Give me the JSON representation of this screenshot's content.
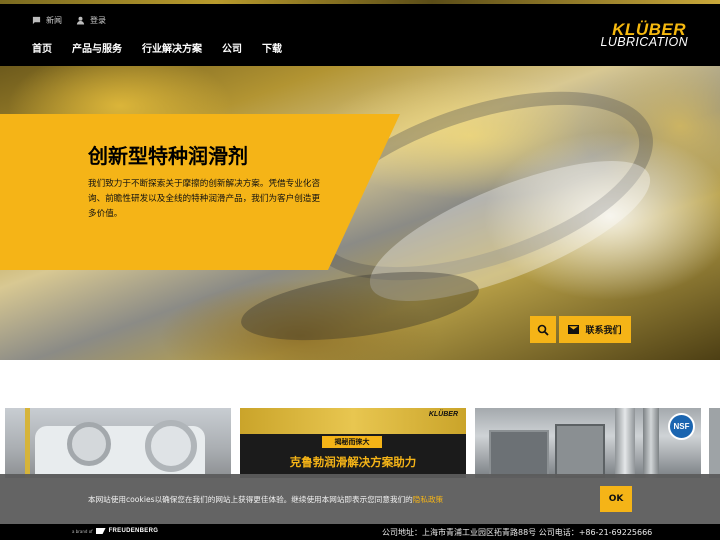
{
  "header": {
    "utility": [
      {
        "label": "新闻",
        "icon": "chat-icon"
      },
      {
        "label": "登录",
        "icon": "user-icon"
      }
    ],
    "nav": [
      "首页",
      "产品与服务",
      "行业解决方案",
      "公司",
      "下载"
    ],
    "logo": {
      "line1": "KLÜBER",
      "line2": "LUBRICATION"
    }
  },
  "hero": {
    "title": "创新型特种润滑剂",
    "text": "我们致力于不断探索关于摩擦的创新解决方案。凭借专业化咨询、前瞻性研发以及全线的特种润滑产品，我们为客户创造更多价值。",
    "contact_label": "联系我们"
  },
  "cards": [
    {
      "name": "card-industrial-machinery"
    },
    {
      "name": "card-marine-solutions",
      "logo": "KLÜBER",
      "badge": "揭秘而徕大",
      "headline": "克鲁勃润滑解决方案助力"
    },
    {
      "name": "card-nsf-certified",
      "badge": "NSF"
    }
  ],
  "cookie": {
    "text": "本网站使用cookies以确保您在我们的网站上获得更佳体验。继续使用本网站即表示您同意我们的",
    "link": "隐私政策",
    "ok": "OK"
  },
  "footer": {
    "parent_small": "a brand of",
    "parent_name": "FREUDENBERG",
    "address": "公司地址：上海市青浦工业园区拓青路88号 公司电话：+86-21-69225666"
  },
  "colors": {
    "accent": "#f5b417",
    "header_bg": "#000000",
    "cookie_bg": "#5c5c5c"
  }
}
